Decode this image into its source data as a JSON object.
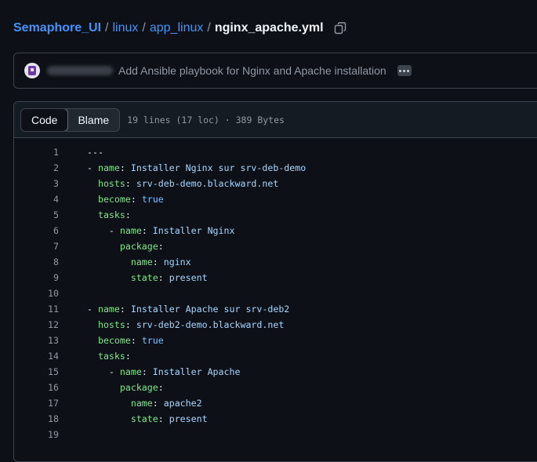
{
  "breadcrumb": {
    "repo": "Semaphore_UI",
    "path": [
      "linux",
      "app_linux"
    ],
    "file": "nginx_apache.yml",
    "separator": "/"
  },
  "commit": {
    "message": "Add Ansible playbook for Nginx and Apache installation"
  },
  "file": {
    "tabs": [
      "Code",
      "Blame"
    ],
    "active_tab": "Code",
    "info": "19 lines (17 loc) · 389 Bytes"
  },
  "code_lines": [
    [
      {
        "t": "---",
        "c": "p"
      }
    ],
    [
      {
        "t": "- ",
        "c": "p"
      },
      {
        "t": "name",
        "c": "k"
      },
      {
        "t": ": ",
        "c": "p"
      },
      {
        "t": "Installer Nginx sur srv-deb-demo",
        "c": "s"
      }
    ],
    [
      {
        "t": "  ",
        "c": "p"
      },
      {
        "t": "hosts",
        "c": "k"
      },
      {
        "t": ": ",
        "c": "p"
      },
      {
        "t": "srv-deb-demo.blackward.net",
        "c": "s"
      }
    ],
    [
      {
        "t": "  ",
        "c": "p"
      },
      {
        "t": "become",
        "c": "k"
      },
      {
        "t": ": ",
        "c": "p"
      },
      {
        "t": "true",
        "c": "c"
      }
    ],
    [
      {
        "t": "  ",
        "c": "p"
      },
      {
        "t": "tasks",
        "c": "k"
      },
      {
        "t": ":",
        "c": "p"
      }
    ],
    [
      {
        "t": "    - ",
        "c": "p"
      },
      {
        "t": "name",
        "c": "k"
      },
      {
        "t": ": ",
        "c": "p"
      },
      {
        "t": "Installer Nginx",
        "c": "s"
      }
    ],
    [
      {
        "t": "      ",
        "c": "p"
      },
      {
        "t": "package",
        "c": "k"
      },
      {
        "t": ":",
        "c": "p"
      }
    ],
    [
      {
        "t": "        ",
        "c": "p"
      },
      {
        "t": "name",
        "c": "k"
      },
      {
        "t": ": ",
        "c": "p"
      },
      {
        "t": "nginx",
        "c": "s"
      }
    ],
    [
      {
        "t": "        ",
        "c": "p"
      },
      {
        "t": "state",
        "c": "k"
      },
      {
        "t": ": ",
        "c": "p"
      },
      {
        "t": "present",
        "c": "s"
      }
    ],
    [],
    [
      {
        "t": "- ",
        "c": "p"
      },
      {
        "t": "name",
        "c": "k"
      },
      {
        "t": ": ",
        "c": "p"
      },
      {
        "t": "Installer Apache sur srv-deb2",
        "c": "s"
      }
    ],
    [
      {
        "t": "  ",
        "c": "p"
      },
      {
        "t": "hosts",
        "c": "k"
      },
      {
        "t": ": ",
        "c": "p"
      },
      {
        "t": "srv-deb2-demo.blackward.net",
        "c": "s"
      }
    ],
    [
      {
        "t": "  ",
        "c": "p"
      },
      {
        "t": "become",
        "c": "k"
      },
      {
        "t": ": ",
        "c": "p"
      },
      {
        "t": "true",
        "c": "c"
      }
    ],
    [
      {
        "t": "  ",
        "c": "p"
      },
      {
        "t": "tasks",
        "c": "k"
      },
      {
        "t": ":",
        "c": "p"
      }
    ],
    [
      {
        "t": "    - ",
        "c": "p"
      },
      {
        "t": "name",
        "c": "k"
      },
      {
        "t": ": ",
        "c": "p"
      },
      {
        "t": "Installer Apache",
        "c": "s"
      }
    ],
    [
      {
        "t": "      ",
        "c": "p"
      },
      {
        "t": "package",
        "c": "k"
      },
      {
        "t": ":",
        "c": "p"
      }
    ],
    [
      {
        "t": "        ",
        "c": "p"
      },
      {
        "t": "name",
        "c": "k"
      },
      {
        "t": ": ",
        "c": "p"
      },
      {
        "t": "apache2",
        "c": "s"
      }
    ],
    [
      {
        "t": "        ",
        "c": "p"
      },
      {
        "t": "state",
        "c": "k"
      },
      {
        "t": ": ",
        "c": "p"
      },
      {
        "t": "present",
        "c": "s"
      }
    ],
    []
  ],
  "icons": {
    "copy": "copy-icon",
    "avatar": "avatar",
    "more": "kebab-horizontal-icon"
  },
  "colors": {
    "background": "#0d1117",
    "link": "#4493f8",
    "yaml_key": "#7ee787",
    "yaml_string": "#a5d6ff",
    "yaml_constant": "#79c0ff",
    "muted": "#9198a1"
  }
}
